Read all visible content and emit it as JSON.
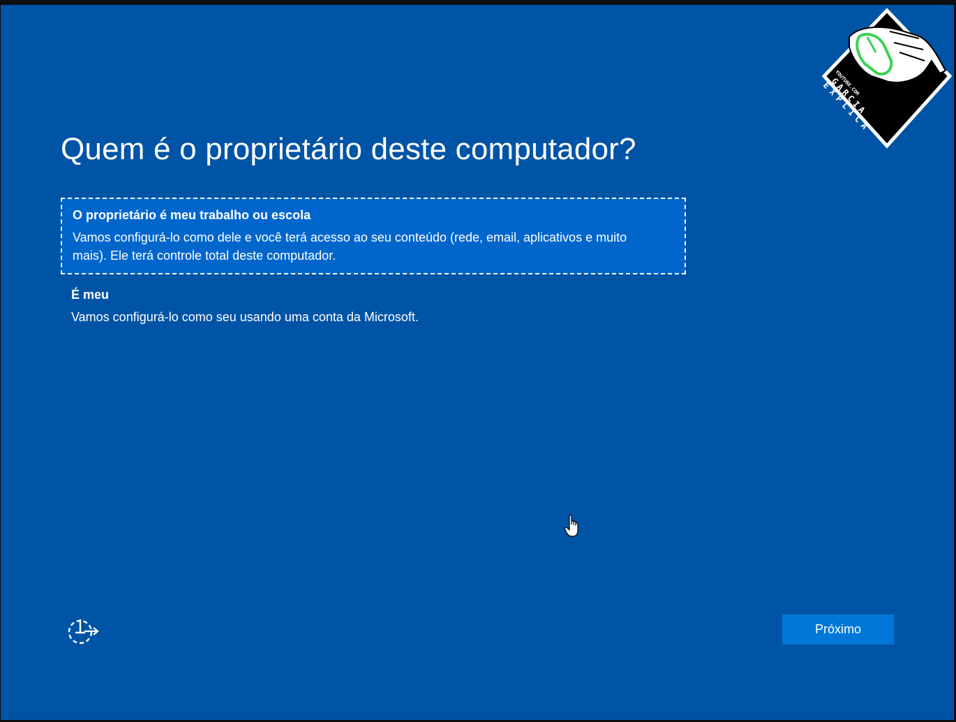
{
  "page": {
    "title": "Quem é o proprietário deste computador?"
  },
  "options": [
    {
      "title": "O proprietário é meu trabalho ou escola",
      "description": "Vamos configurá-lo como dele e você terá acesso ao seu conteúdo (rede, email, aplicativos e muito mais). Ele terá controle total deste computador.",
      "selected": true
    },
    {
      "title": "É meu",
      "description": "Vamos configurá-lo como seu usando uma conta da Microsoft.",
      "selected": false
    }
  ],
  "footer": {
    "next_label": "Próximo",
    "accessibility_icon": "ease-of-access-icon"
  },
  "watermark": {
    "line_small": "YOUTUBE.COM",
    "line_mid": "GARCIA",
    "line_big": "EXPLICA"
  },
  "colors": {
    "background": "#0054a6",
    "selected_option": "#0066cc",
    "next_button": "#0078d7",
    "text": "#ffffff",
    "logo_accent": "#39d353"
  }
}
